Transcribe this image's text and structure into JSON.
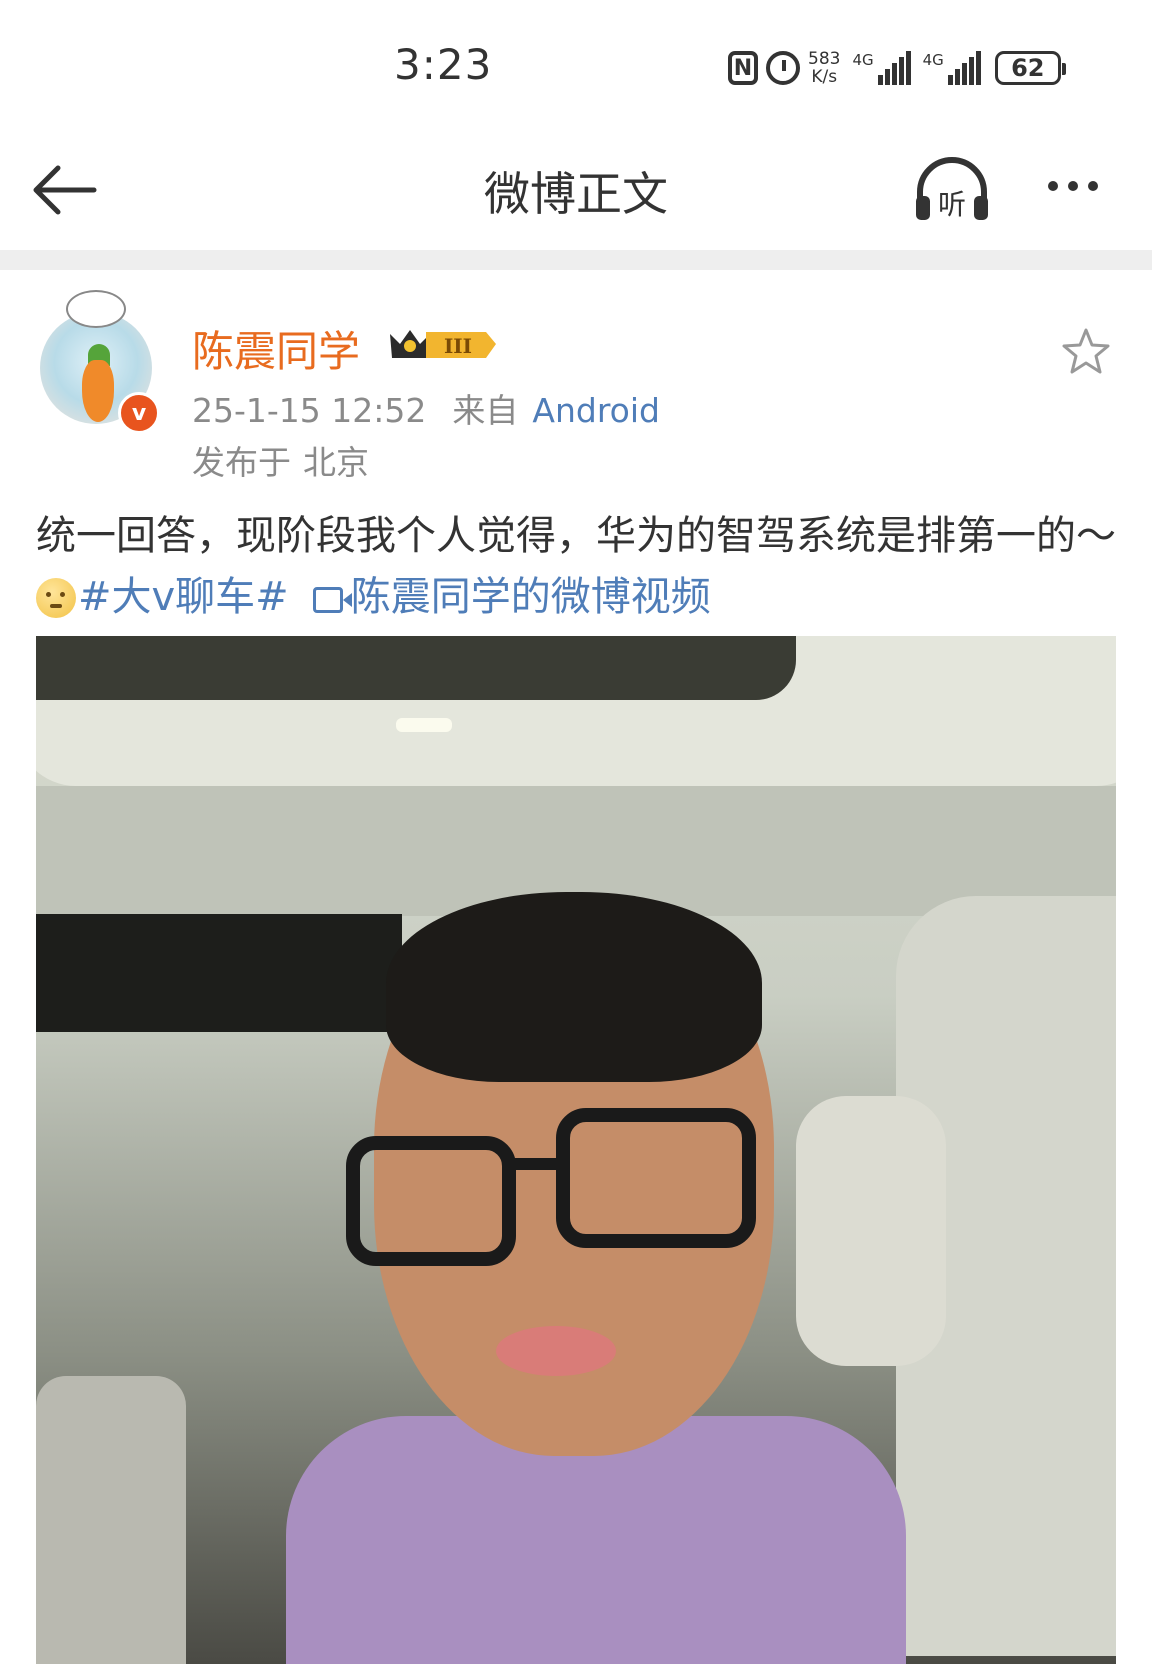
{
  "status_bar": {
    "time": "3:23",
    "speed_value": "583",
    "speed_unit": "K/s",
    "net1": "4G",
    "net2": "4G",
    "battery": "62",
    "icons": [
      "nfc-icon",
      "alarm-icon",
      "signal-icon",
      "battery-icon"
    ]
  },
  "nav": {
    "title": "微博正文",
    "listen_label": "听"
  },
  "post": {
    "author": "陈震同学",
    "badge_level": "III",
    "date": "25-1-15 12:52",
    "from_label": "来自",
    "source": "Android",
    "location_prefix": "发布于",
    "location": "北京",
    "verified_mark": "v",
    "text_main": "统一回答，现阶段我个人觉得，华为的智驾系统是排第一的～",
    "topic": "#大v聊车#",
    "video_link": "陈震同学的微博视频"
  },
  "colors": {
    "author": "#e86b1f",
    "link": "#4f7db8",
    "meta": "#8a8a8a",
    "divider": "#eeeeee"
  }
}
